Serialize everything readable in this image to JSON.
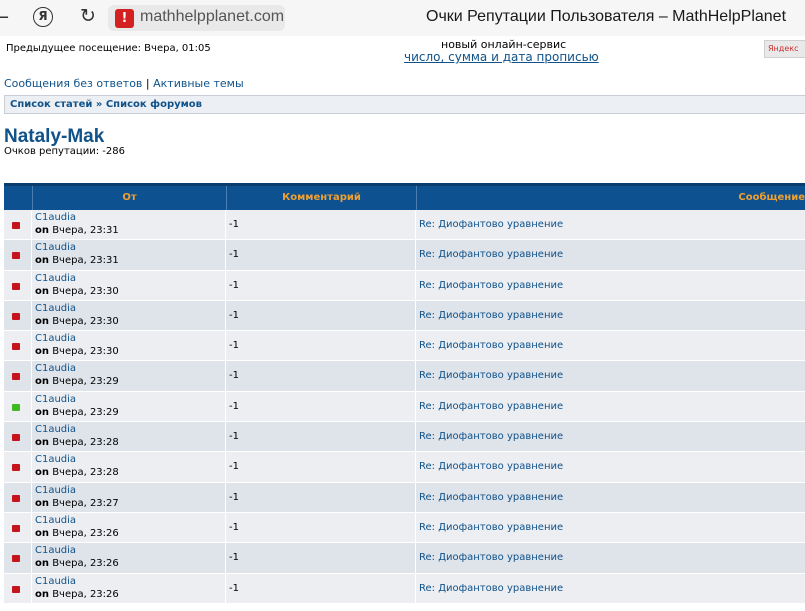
{
  "browser": {
    "back_icon": "arrow-left-icon",
    "yandex_button": "Я",
    "reload_icon": "reload-icon",
    "warning_icon": "warning-icon",
    "url": "mathhelpplanet.com",
    "page_title": "Очки Репутации Пользователя – MathHelpPlanet"
  },
  "header": {
    "last_visit": "Предыдущее посещение: Вчера, 01:05",
    "promo_top": "новый онлайн-сервис",
    "promo_link": "число, сумма и дата прописью",
    "yandex_badge": "Яндекс"
  },
  "links": {
    "unanswered": "Сообщения без ответов",
    "separator": "|",
    "active": "Активные темы"
  },
  "breadcrumb": {
    "articles": "Список статей",
    "separator": "»",
    "forums": "Список форумов"
  },
  "user": {
    "name": "Nataly-Mak",
    "reputation": "Очков репутации: -286"
  },
  "table": {
    "headers": {
      "from": "От",
      "comment": "Комментарий",
      "message": "Сообщение"
    },
    "rows": [
      {
        "status": "negative",
        "from": "C1audia",
        "on": "on",
        "date": "Вчера, 23:31",
        "comment": "-1",
        "message": "Re: Диофантово уравнение"
      },
      {
        "status": "negative",
        "from": "C1audia",
        "on": "on",
        "date": "Вчера, 23:31",
        "comment": "-1",
        "message": "Re: Диофантово уравнение"
      },
      {
        "status": "negative",
        "from": "C1audia",
        "on": "on",
        "date": "Вчера, 23:30",
        "comment": "-1",
        "message": "Re: Диофантово уравнение"
      },
      {
        "status": "negative",
        "from": "C1audia",
        "on": "on",
        "date": "Вчера, 23:30",
        "comment": "-1",
        "message": "Re: Диофантово уравнение"
      },
      {
        "status": "negative",
        "from": "C1audia",
        "on": "on",
        "date": "Вчера, 23:30",
        "comment": "-1",
        "message": "Re: Диофантово уравнение"
      },
      {
        "status": "negative",
        "from": "C1audia",
        "on": "on",
        "date": "Вчера, 23:29",
        "comment": "-1",
        "message": "Re: Диофантово уравнение"
      },
      {
        "status": "positive",
        "from": "C1audia",
        "on": "on",
        "date": "Вчера, 23:29",
        "comment": "-1",
        "message": "Re: Диофантово уравнение"
      },
      {
        "status": "negative",
        "from": "C1audia",
        "on": "on",
        "date": "Вчера, 23:28",
        "comment": "-1",
        "message": "Re: Диофантово уравнение"
      },
      {
        "status": "negative",
        "from": "C1audia",
        "on": "on",
        "date": "Вчера, 23:28",
        "comment": "-1",
        "message": "Re: Диофантово уравнение"
      },
      {
        "status": "negative",
        "from": "C1audia",
        "on": "on",
        "date": "Вчера, 23:27",
        "comment": "-1",
        "message": "Re: Диофантово уравнение"
      },
      {
        "status": "negative",
        "from": "C1audia",
        "on": "on",
        "date": "Вчера, 23:26",
        "comment": "-1",
        "message": "Re: Диофантово уравнение"
      },
      {
        "status": "negative",
        "from": "C1audia",
        "on": "on",
        "date": "Вчера, 23:26",
        "comment": "-1",
        "message": "Re: Диофантово уравнение"
      },
      {
        "status": "negative",
        "from": "C1audia",
        "on": "on",
        "date": "Вчера, 23:26",
        "comment": "-1",
        "message": "Re: Диофантово уравнение"
      }
    ]
  }
}
